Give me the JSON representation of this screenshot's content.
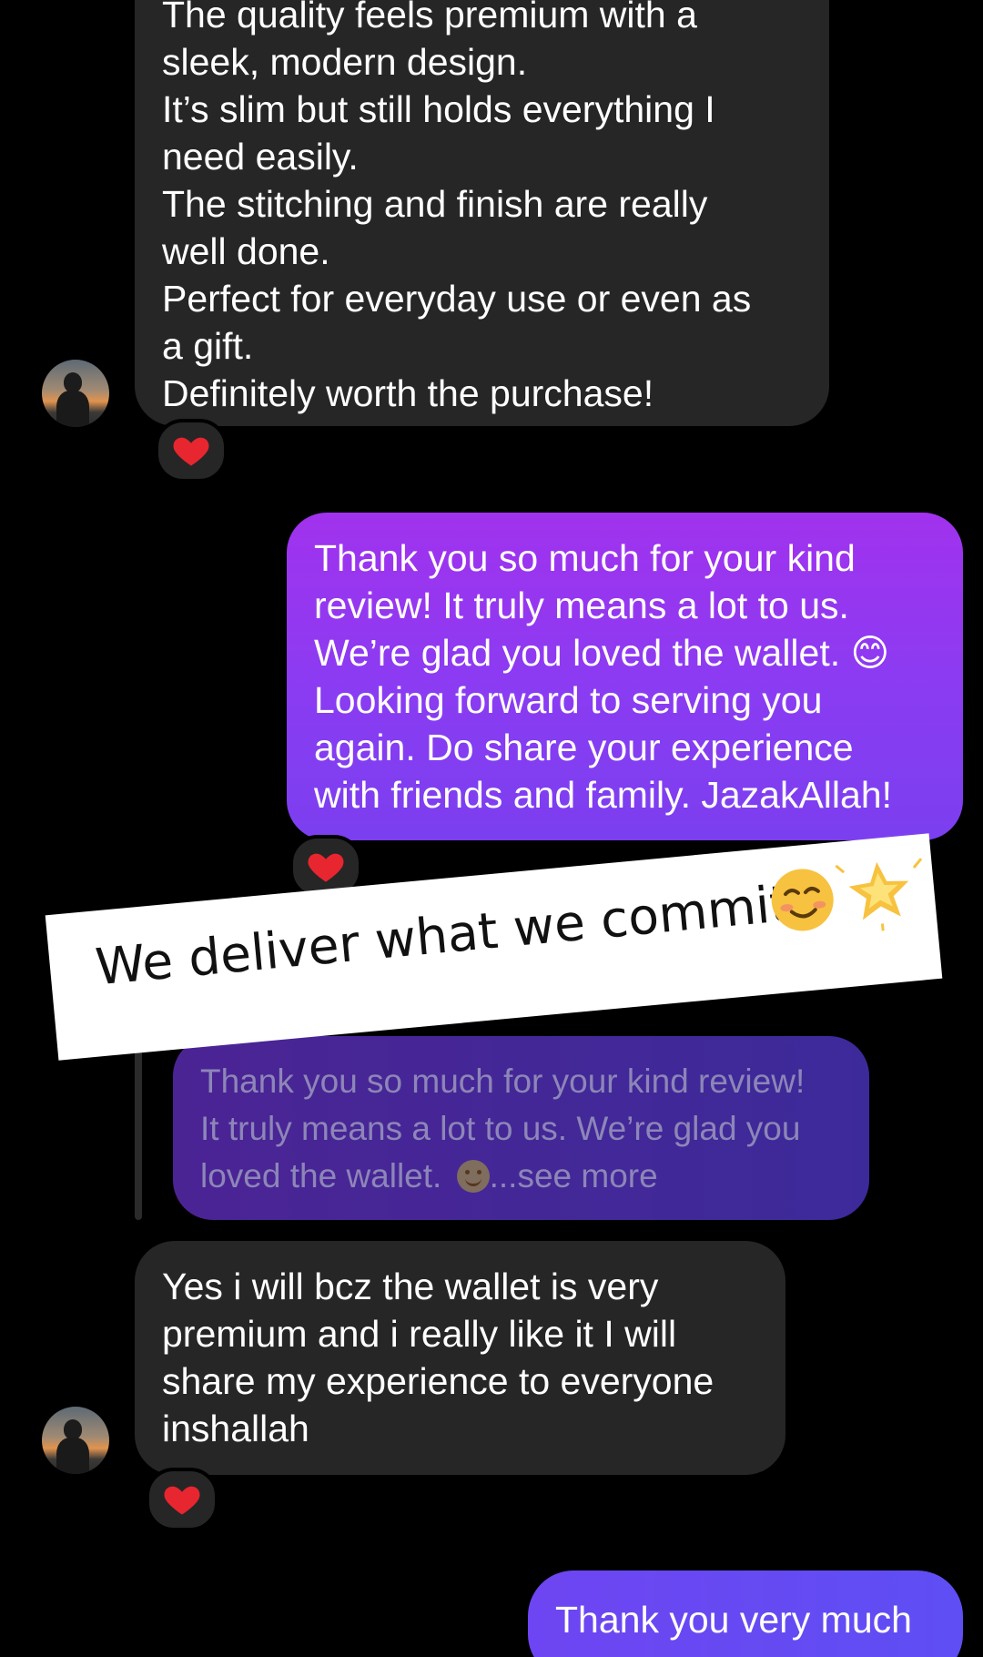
{
  "messages": {
    "incoming_review": {
      "text": "The quality feels premium with a\nsleek, modern design.\nIt’s slim but still holds everything I\nneed easily.\nThe stitching and finish are really\nwell done.\nPerfect for everyday use or even as\na gift.\nDefinitely worth the purchase!",
      "reaction": "❤️"
    },
    "outgoing_thanks": {
      "text": "Thank you so much for your kind\nreview! It truly means a lot to us.\nWe’re glad you loved the wallet. 😊\nLooking forward to serving you\nagain. Do share your experience\nwith friends and family. JazakAllah!",
      "reaction": "❤️"
    },
    "quoted_reply": {
      "line1": "Thank you so much for your kind review!",
      "line2": "It truly means a lot to us. We’re glad you",
      "line3": "loved the wallet.",
      "see_more": "...see more"
    },
    "incoming_reply": {
      "text": "Yes i will bcz the wallet is very\npremium and i really like it I will\nshare my experience to everyone\ninshallah",
      "reaction": "❤️"
    },
    "outgoing_final": {
      "text": "Thank you very much"
    }
  },
  "sticker": {
    "text": "We deliver what we commit",
    "emojis": [
      "smiling-face-icon",
      "glowing-star-icon"
    ]
  },
  "colors": {
    "background": "#000000",
    "incoming_bubble": "#262626",
    "outgoing_gradient_top": "#a132ee",
    "outgoing_gradient_bottom": "#7b3ff0",
    "heart": "#e8262f"
  }
}
